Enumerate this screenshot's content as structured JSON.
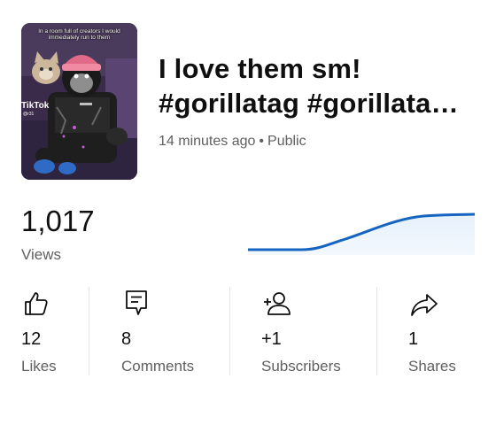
{
  "video": {
    "thumbnail_caption": "In a room full of creators I would immediately run to them",
    "thumbnail_watermark": "TikTok",
    "thumbnail_watermark_sub": "@r31",
    "title_line1": "I love them sm!",
    "title_line2": "#gorillatag #gorillata…",
    "age": "14 minutes ago",
    "separator": "•",
    "visibility": "Public"
  },
  "views": {
    "count": "1,017",
    "label": "Views",
    "trend_color": "#1565c0"
  },
  "stats": [
    {
      "icon": "thumbs-up-icon",
      "value": "12",
      "label": "Likes"
    },
    {
      "icon": "comment-icon",
      "value": "8",
      "label": "Comments"
    },
    {
      "icon": "add-person-icon",
      "value": "+1",
      "label": "Subscribers"
    },
    {
      "icon": "share-icon",
      "value": "1",
      "label": "Shares"
    }
  ]
}
